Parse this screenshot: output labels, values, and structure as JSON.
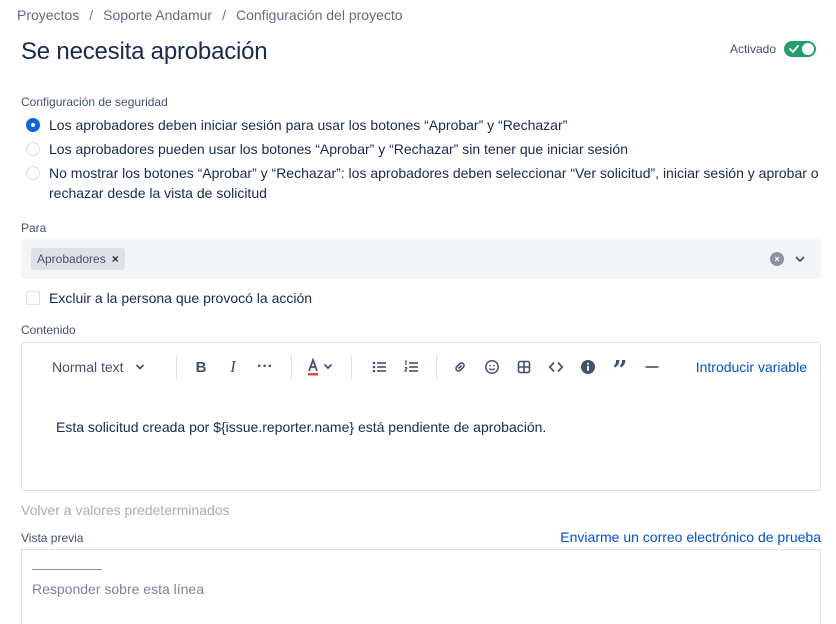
{
  "breadcrumb": {
    "items": [
      "Proyectos",
      "Soporte Andamur",
      "Configuración del proyecto"
    ],
    "separator": "/"
  },
  "page_title": "Se necesita aprobación",
  "toggle": {
    "label": "Activado",
    "state": "on",
    "color": "#22a06b"
  },
  "security": {
    "label": "Configuración de seguridad",
    "options": [
      {
        "text": "Los aprobadores deben iniciar sesión para usar los botones “Aprobar” y “Rechazar”",
        "selected": true
      },
      {
        "text": "Los aprobadores pueden usar los botones “Aprobar” y “Rechazar” sin tener que iniciar sesión",
        "selected": false
      },
      {
        "text": "No mostrar los botones “Aprobar” y “Rechazar”: los aprobadores deben seleccionar “Ver solicitud”, iniciar sesión y aprobar o rechazar desde la vista de solicitud",
        "selected": false
      }
    ]
  },
  "para": {
    "label": "Para",
    "tags": [
      "Aprobadores"
    ]
  },
  "exclude": {
    "label": "Excluir a la persona que provocó la acción",
    "checked": false
  },
  "contenido": {
    "label": "Contenido",
    "toolbar": {
      "text_style": "Normal text",
      "insert_variable": "Introducir variable",
      "icons": [
        "bold-icon",
        "italic-icon",
        "more-icon",
        "text-color-icon",
        "bullet-list-icon",
        "numbered-list-icon",
        "link-icon",
        "emoji-icon",
        "table-icon",
        "code-icon",
        "info-icon",
        "quote-icon",
        "divider-icon"
      ]
    },
    "body": "Esta solicitud creada por ${issue.reporter.name} está pendiente de aprobación."
  },
  "reset_label": "Volver a valores predeterminados",
  "preview": {
    "label": "Vista previa",
    "test_email": "Enviarme un correo electrónico de prueba",
    "reply_line": "Responder sobre esta línea"
  },
  "colors": {
    "accent": "#0052cc",
    "radio_selected": "#0c66e4"
  }
}
